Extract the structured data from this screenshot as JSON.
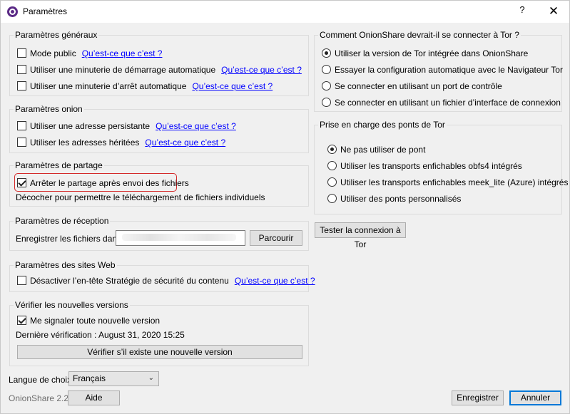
{
  "window": {
    "title": "Paramètres",
    "help": "?",
    "close": "✕"
  },
  "general": {
    "title": "Paramètres généraux",
    "items": [
      {
        "label": "Mode public",
        "link": "Qu’est-ce que c’est ?",
        "checked": false
      },
      {
        "label": "Utiliser une minuterie de démarrage automatique",
        "link": "Qu’est-ce que c’est ?",
        "checked": false
      },
      {
        "label": "Utiliser une minuterie d’arrêt automatique",
        "link": "Qu’est-ce que c’est ?",
        "checked": false
      }
    ]
  },
  "onion": {
    "title": "Paramètres onion",
    "items": [
      {
        "label": "Utiliser une adresse persistante",
        "link": "Qu’est-ce que c’est ?",
        "checked": false
      },
      {
        "label": "Utiliser les adresses héritées",
        "link": "Qu’est-ce que c’est ?",
        "checked": false
      }
    ]
  },
  "sharing": {
    "title": "Paramètres de partage",
    "stop_label": "Arrêter le partage après envoi des fichiers",
    "stop_checked": true,
    "hint": "Décocher pour permettre le téléchargement de fichiers individuels"
  },
  "receiving": {
    "title": "Paramètres de réception",
    "save_label": "Enregistrer les fichiers dans",
    "browse": "Parcourir"
  },
  "website": {
    "title": "Paramètres des sites Web",
    "csp_label": "Désactiver l’en-tête Stratégie de sécurité du contenu",
    "link": "Qu’est-ce que c’est ?"
  },
  "updates": {
    "title": "Vérifier les nouvelles versions",
    "notify_label": "Me signaler toute nouvelle version",
    "notify_checked": true,
    "last_check": "Dernière vérification : August 31, 2020 15:25",
    "check_button": "Vérifier s’il existe une nouvelle version"
  },
  "language": {
    "label": "Langue de choix",
    "value": "Français"
  },
  "footer": {
    "version": "OnionShare 2.2",
    "help": "Aide",
    "save": "Enregistrer",
    "cancel": "Annuler"
  },
  "tor": {
    "title": "Comment OnionShare devrait-il se connecter à Tor ?",
    "options": [
      {
        "label": "Utiliser la version de Tor intégrée dans OnionShare",
        "selected": true
      },
      {
        "label": "Essayer la configuration automatique avec le Navigateur Tor",
        "selected": false
      },
      {
        "label": "Se connecter en utilisant un port de contrôle",
        "selected": false
      },
      {
        "label": "Se connecter en utilisant un fichier d’interface de connexion",
        "selected": false
      }
    ]
  },
  "bridges": {
    "title": "Prise en charge des ponts de Tor",
    "options": [
      {
        "label": "Ne pas utiliser de pont",
        "selected": true
      },
      {
        "label": "Utiliser les transports enfichables obfs4 intégrés",
        "selected": false
      },
      {
        "label": "Utiliser les transports enfichables meek_lite (Azure) intégrés",
        "selected": false
      },
      {
        "label": "Utiliser des ponts personnalisés",
        "selected": false
      }
    ]
  },
  "test_button": "Tester la connexion à Tor",
  "colors": {
    "link": "#0000ff",
    "highlight": "#d42a2a",
    "default_button": "#0078d7"
  }
}
